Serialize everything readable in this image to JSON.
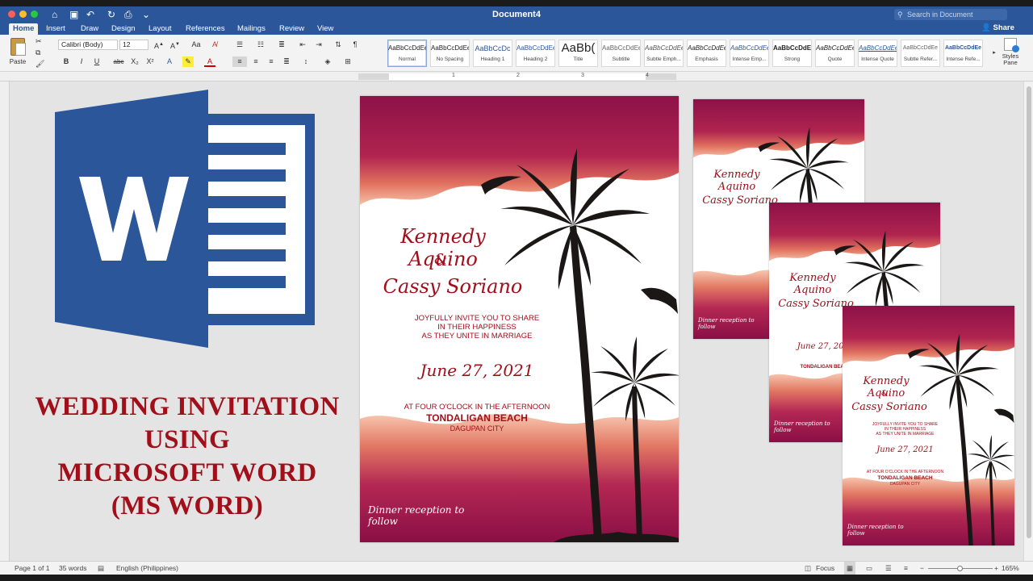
{
  "window": {
    "title": "Document4",
    "search_placeholder": "Search in Document",
    "share_label": "Share"
  },
  "tabs": [
    "Home",
    "Insert",
    "Draw",
    "Design",
    "Layout",
    "References",
    "Mailings",
    "Review",
    "View"
  ],
  "ribbon": {
    "paste_label": "Paste",
    "font_name": "Calibri (Body)",
    "font_size": "12",
    "bold": "B",
    "italic": "I",
    "underline": "U",
    "strike": "abc",
    "subscript": "X₂",
    "superscript": "X²",
    "styles": [
      {
        "preview": "AaBbCcDdEe",
        "name": "Normal"
      },
      {
        "preview": "AaBbCcDdEe",
        "name": "No Spacing"
      },
      {
        "preview": "AaBbCcDc",
        "name": "Heading 1"
      },
      {
        "preview": "AaBbCcDdEe",
        "name": "Heading 2"
      },
      {
        "preview": "AaBb(",
        "name": "Title"
      },
      {
        "preview": "AaBbCcDdEe",
        "name": "Subtitle"
      },
      {
        "preview": "AaBbCcDdEe",
        "name": "Subtle Emph..."
      },
      {
        "preview": "AaBbCcDdEe",
        "name": "Emphasis"
      },
      {
        "preview": "AaBbCcDdEe",
        "name": "Intense Emp..."
      },
      {
        "preview": "AaBbCcDdEe",
        "name": "Strong"
      },
      {
        "preview": "AaBbCcDdEe",
        "name": "Quote"
      },
      {
        "preview": "AaBbCcDdEe",
        "name": "Intense Quote"
      },
      {
        "preview": "AaBbCcDdEe",
        "name": "Subtle Refer..."
      },
      {
        "preview": "AaBbCcDdEe",
        "name": "Intense Refe..."
      }
    ],
    "styles_pane_label": "Styles Pane"
  },
  "ruler": {
    "labels": [
      "1",
      "2",
      "3",
      "4"
    ]
  },
  "thumbnail": {
    "headline_lines": [
      "WEDDING INVITATION",
      "USING",
      "MICROSOFT WORD",
      "(MS WORD)"
    ],
    "invitation": {
      "name1": "Kennedy Aquino",
      "amp": "&",
      "name2": "Cassy Soriano",
      "invite_lines": [
        "JOYFULLY INVITE YOU TO SHARE",
        "IN THEIR HAPPINESS",
        "AS THEY UNITE IN MARRIAGE"
      ],
      "date": "June 27, 2021",
      "time": "AT FOUR O'CLOCK IN THE AFTERNOON",
      "venue": "TONDALIGAN BEACH",
      "city": "DAGUPAN CITY",
      "dinner": "Dinner reception to follow"
    }
  },
  "statusbar": {
    "page": "Page 1 of 1",
    "words": "35 words",
    "language": "English (Philippines)",
    "focus": "Focus",
    "zoom": "165%"
  },
  "colors": {
    "word_blue": "#2b579a",
    "invite_red": "#a10f1b",
    "magenta": "#8f1146"
  }
}
